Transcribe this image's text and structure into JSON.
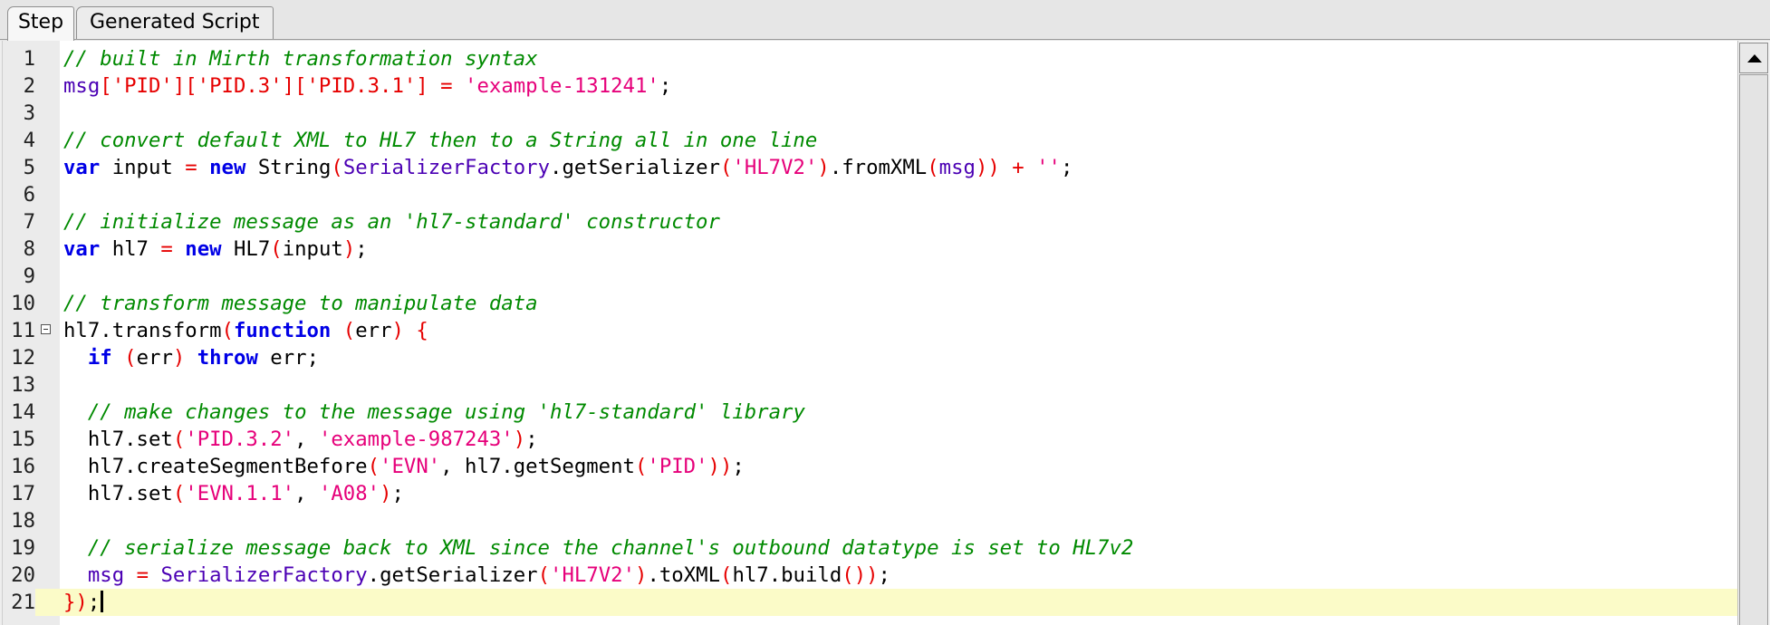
{
  "tabs": {
    "step": "Step",
    "generated_script": "Generated Script"
  },
  "editor": {
    "current_line": "21",
    "lines": [
      {
        "n": "1",
        "t": [
          [
            "cm",
            "// built in Mirth transformation syntax"
          ]
        ]
      },
      {
        "n": "2",
        "t": [
          [
            "id",
            "msg"
          ],
          [
            "pn",
            "['PID']['PID.3']['PID.3.1']"
          ],
          [
            "tx",
            " "
          ],
          [
            "pn",
            "="
          ],
          [
            "tx",
            " "
          ],
          [
            "str",
            "'example-131241'"
          ],
          [
            "tx",
            ";"
          ]
        ]
      },
      {
        "n": "3",
        "t": []
      },
      {
        "n": "4",
        "t": [
          [
            "cm",
            "// convert default XML to HL7 then to a String all in one line"
          ]
        ]
      },
      {
        "n": "5",
        "t": [
          [
            "kw",
            "var"
          ],
          [
            "tx",
            " input "
          ],
          [
            "pn",
            "="
          ],
          [
            "tx",
            " "
          ],
          [
            "kw",
            "new"
          ],
          [
            "tx",
            " String"
          ],
          [
            "pn",
            "("
          ],
          [
            "id",
            "SerializerFactory"
          ],
          [
            "tx",
            ".getSerializer"
          ],
          [
            "pn",
            "("
          ],
          [
            "str",
            "'HL7V2'"
          ],
          [
            "pn",
            ")"
          ],
          [
            "tx",
            ".fromXML"
          ],
          [
            "pn",
            "("
          ],
          [
            "id",
            "msg"
          ],
          [
            "pn",
            "))"
          ],
          [
            "tx",
            " "
          ],
          [
            "pn",
            "+"
          ],
          [
            "tx",
            " "
          ],
          [
            "str",
            "''"
          ],
          [
            "tx",
            ";"
          ]
        ]
      },
      {
        "n": "6",
        "t": []
      },
      {
        "n": "7",
        "t": [
          [
            "cm",
            "// initialize message as an 'hl7-standard' constructor"
          ]
        ]
      },
      {
        "n": "8",
        "t": [
          [
            "kw",
            "var"
          ],
          [
            "tx",
            " hl7 "
          ],
          [
            "pn",
            "="
          ],
          [
            "tx",
            " "
          ],
          [
            "kw",
            "new"
          ],
          [
            "tx",
            " HL7"
          ],
          [
            "pn",
            "("
          ],
          [
            "tx",
            "input"
          ],
          [
            "pn",
            ")"
          ],
          [
            "tx",
            ";"
          ]
        ]
      },
      {
        "n": "9",
        "t": []
      },
      {
        "n": "10",
        "t": [
          [
            "cm",
            "// transform message to manipulate data"
          ]
        ]
      },
      {
        "n": "11",
        "fold": true,
        "t": [
          [
            "tx",
            "hl7.transform"
          ],
          [
            "pn",
            "("
          ],
          [
            "kw",
            "function"
          ],
          [
            "tx",
            " "
          ],
          [
            "pn",
            "("
          ],
          [
            "tx",
            "err"
          ],
          [
            "pn",
            ")"
          ],
          [
            "tx",
            " "
          ],
          [
            "pn",
            "{"
          ]
        ]
      },
      {
        "n": "12",
        "t": [
          [
            "tx",
            "  "
          ],
          [
            "kw",
            "if"
          ],
          [
            "tx",
            " "
          ],
          [
            "pn",
            "("
          ],
          [
            "tx",
            "err"
          ],
          [
            "pn",
            ")"
          ],
          [
            "tx",
            " "
          ],
          [
            "kw",
            "throw"
          ],
          [
            "tx",
            " err;"
          ]
        ]
      },
      {
        "n": "13",
        "t": []
      },
      {
        "n": "14",
        "t": [
          [
            "tx",
            "  "
          ],
          [
            "cm",
            "// make changes to the message using 'hl7-standard' library"
          ]
        ]
      },
      {
        "n": "15",
        "t": [
          [
            "tx",
            "  hl7.set"
          ],
          [
            "pn",
            "("
          ],
          [
            "str",
            "'PID.3.2'"
          ],
          [
            "tx",
            ", "
          ],
          [
            "str",
            "'example-987243'"
          ],
          [
            "pn",
            ")"
          ],
          [
            "tx",
            ";"
          ]
        ]
      },
      {
        "n": "16",
        "t": [
          [
            "tx",
            "  hl7.createSegmentBefore"
          ],
          [
            "pn",
            "("
          ],
          [
            "str",
            "'EVN'"
          ],
          [
            "tx",
            ", hl7.getSegment"
          ],
          [
            "pn",
            "("
          ],
          [
            "str",
            "'PID'"
          ],
          [
            "pn",
            "))"
          ],
          [
            "tx",
            ";"
          ]
        ]
      },
      {
        "n": "17",
        "t": [
          [
            "tx",
            "  hl7.set"
          ],
          [
            "pn",
            "("
          ],
          [
            "str",
            "'EVN.1.1'"
          ],
          [
            "tx",
            ", "
          ],
          [
            "str",
            "'A08'"
          ],
          [
            "pn",
            ")"
          ],
          [
            "tx",
            ";"
          ]
        ]
      },
      {
        "n": "18",
        "t": []
      },
      {
        "n": "19",
        "t": [
          [
            "tx",
            "  "
          ],
          [
            "cm",
            "// serialize message back to XML since the channel's outbound datatype is set to HL7v2"
          ]
        ]
      },
      {
        "n": "20",
        "t": [
          [
            "tx",
            "  "
          ],
          [
            "id",
            "msg"
          ],
          [
            "tx",
            " "
          ],
          [
            "pn",
            "="
          ],
          [
            "tx",
            " "
          ],
          [
            "id",
            "SerializerFactory"
          ],
          [
            "tx",
            ".getSerializer"
          ],
          [
            "pn",
            "("
          ],
          [
            "str",
            "'HL7V2'"
          ],
          [
            "pn",
            ")"
          ],
          [
            "tx",
            ".toXML"
          ],
          [
            "pn",
            "("
          ],
          [
            "tx",
            "hl7.build"
          ],
          [
            "pn",
            "())"
          ],
          [
            "tx",
            ";"
          ]
        ]
      },
      {
        "n": "21",
        "t": [
          [
            "pn",
            "})"
          ],
          [
            "tx",
            ";"
          ]
        ]
      }
    ]
  }
}
